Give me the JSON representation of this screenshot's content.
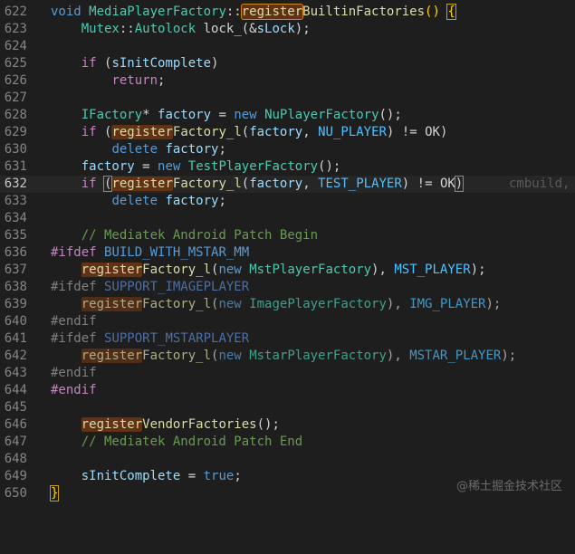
{
  "lines": {
    "n622": "622",
    "n623": "623",
    "n624": "624",
    "n625": "625",
    "n626": "626",
    "n627": "627",
    "n628": "628",
    "n629": "629",
    "n630": "630",
    "n631": "631",
    "n632": "632",
    "n633": "633",
    "n634": "634",
    "n635": "635",
    "n636": "636",
    "n637": "637",
    "n638": "638",
    "n639": "639",
    "n640": "640",
    "n641": "641",
    "n642": "642",
    "n643": "643",
    "n644": "644",
    "n645": "645",
    "n646": "646",
    "n647": "647",
    "n648": "648",
    "n649": "649",
    "n650": "650"
  },
  "t": {
    "void": "void",
    "mpf": "MediaPlayerFactory",
    "colon2": "::",
    "register": "register",
    "builtin_rest": "BuiltinFactories",
    "parens_open": "() ",
    "brace_open": "{",
    "mutex": "Mutex",
    "autolock": "Autolock",
    "lock_decl": " lock_(&",
    "slock": "sLock",
    "close_semi": ");",
    "if": "if",
    "sp_paren": " (",
    "sinit": "sInitComplete",
    "close_paren": ")",
    "return": "return",
    "semi": ";",
    "ifactory": "IFactory",
    "star": "* ",
    "factory": "factory",
    "eq_new_sp": " = ",
    "new": "new",
    "nuplayer": "NuPlayerFactory",
    "call_end": "();",
    "factory_l": "Factory_l",
    "paren_open": "(",
    "comma_sp": ", ",
    "nu_player": "NU_PLAYER",
    "ne_ok": ") != OK",
    "ne_ok_tail": " != OK",
    "delete": "delete",
    "testplayer": "TestPlayerFactory",
    "test_player": "TEST_PLAYER",
    "ok_sp": ") != ",
    "ok": "OK",
    "paren_close": ")",
    "ghost": "cmbuild,",
    "cm_begin": "// Mediatek Android Patch Begin",
    "ifdef": "#ifdef",
    "build_mstar": "BUILD_WITH_MSTAR_MM",
    "mst_factory": "MstPlayerFactory",
    "mst_player": "MST_PLAYER",
    "support_image": "SUPPORT_IMAGEPLAYER",
    "image_factory": "ImagePlayerFactory",
    "img_player": "IMG_PLAYER",
    "endif": "#endif",
    "support_mstar": "SUPPORT_MSTARPLAYER",
    "mstar_factory": "MstarPlayerFactory",
    "mstar_player": "MSTAR_PLAYER",
    "vendor_rest": "VendorFactories",
    "cm_end": "// Mediatek Android Patch End",
    "assign": " = ",
    "true": "true",
    "brace_close": "}"
  },
  "watermark": "@稀土掘金技术社区",
  "colors": {
    "background": "#1e1e1e",
    "keyword": "#569cd6",
    "type": "#4ec9b0",
    "function": "#dcdcaa",
    "variable": "#9cdcfe",
    "comment": "#6a9955",
    "highlight": "#613214"
  }
}
